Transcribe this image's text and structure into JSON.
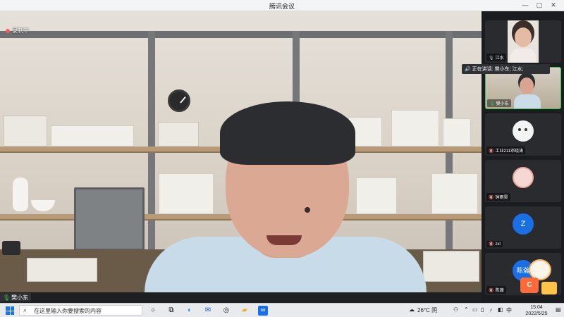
{
  "window": {
    "title": "腾讯会议",
    "controls": {
      "minimize": "—",
      "maximize": "▢",
      "close": "✕"
    }
  },
  "meeting": {
    "recording_label": "录制中",
    "active_speaker": "樊小东",
    "talking_prefix": "正在讲话:",
    "talking_names": "樊小东; 江水;"
  },
  "participants": [
    {
      "name": "江水",
      "type": "video",
      "mic": "on"
    },
    {
      "name": "樊小东",
      "type": "video",
      "mic": "on",
      "active": true
    },
    {
      "name": "工业211邓晓涛",
      "type": "avatar-ghost",
      "mic": "muted"
    },
    {
      "name": "钟雨昊",
      "type": "avatar-anime",
      "mic": "muted"
    },
    {
      "name": "zxl",
      "type": "avatar-letter",
      "avatar_letter": "Z",
      "mic": "muted"
    },
    {
      "name": "陈瀚",
      "type": "avatar-letter",
      "avatar_letter": "陈瀚",
      "mic": "muted"
    }
  ],
  "mascot": {
    "label": "C"
  },
  "taskbar": {
    "search_placeholder": "在这里输入你要搜索的内容",
    "search_icon": "search-icon",
    "apps": [
      "cortana-icon",
      "task-view-icon",
      "edge-icon",
      "mail-icon",
      "dell-icon",
      "folder-icon",
      "tencent-meeting-icon"
    ],
    "weather": "26°C 阴",
    "input_method": "中",
    "time": "15:04",
    "date": "2022/5/25"
  },
  "colors": {
    "accent_blue": "#1a6fe5",
    "active_green": "#35c457",
    "recording_red": "#ff5a4f"
  }
}
